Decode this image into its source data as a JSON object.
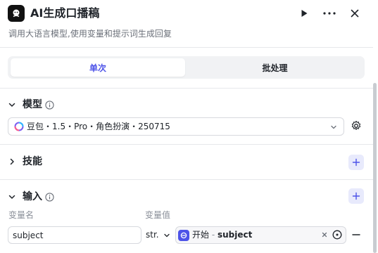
{
  "header": {
    "title": "AI生成口播稿",
    "subtitle": "调用大语言模型,使用变量和提示词生成回复",
    "actions": [
      "play-icon",
      "more-icon",
      "close-icon"
    ]
  },
  "tabs": [
    {
      "label": "单次",
      "active": true
    },
    {
      "label": "批处理",
      "active": false
    }
  ],
  "model_section": {
    "title": "模型",
    "selected_model": "豆包・1.5・Pro・角色扮演・250715"
  },
  "skills_section": {
    "title": "技能"
  },
  "input_section": {
    "title": "输入",
    "columns": {
      "name": "变量名",
      "value": "变量值"
    },
    "rows": [
      {
        "name": "subject",
        "type": "str.",
        "ref_node": "开始",
        "ref_sep": " - ",
        "ref_var": "subject"
      }
    ]
  },
  "colors": {
    "accent": "#4d53e8",
    "accent_light": "#e8eafc",
    "border": "#d7d9de",
    "text": "#1f2329",
    "muted": "#6b7079"
  }
}
